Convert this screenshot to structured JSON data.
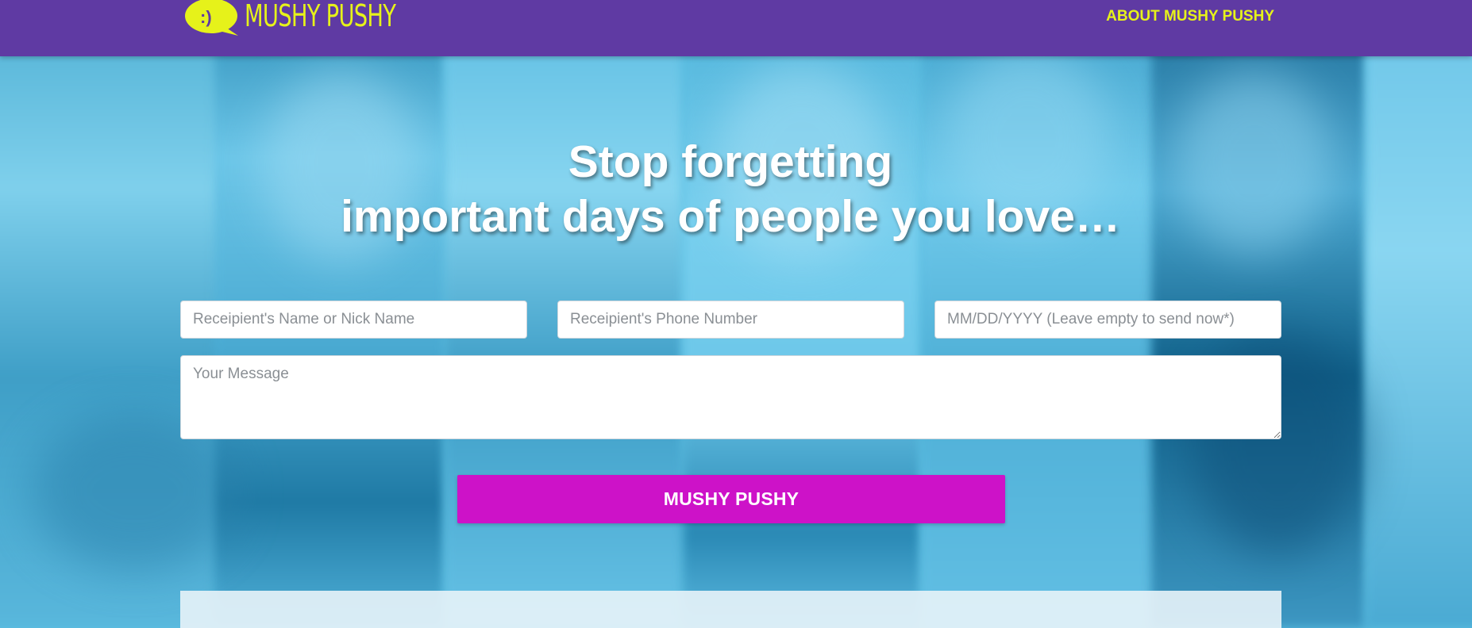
{
  "header": {
    "logo_face": ":)",
    "logo_text": "MUSHY PUSHY",
    "nav_about": "ABOUT MUSHY PUSHY"
  },
  "hero": {
    "line1": "Stop forgetting",
    "line2": "important days of people you love…"
  },
  "form": {
    "name_placeholder": "Receipient's Name or Nick Name",
    "phone_placeholder": "Receipient's Phone Number",
    "date_placeholder": "MM/DD/YYYY (Leave empty to send now*)",
    "message_placeholder": "Your Message",
    "submit_label": "MUSHY PUSHY"
  },
  "bottom_panel": {
    "heading": ""
  },
  "colors": {
    "header_bg": "#5f3aa3",
    "brand_yellow": "#e6f21a",
    "submit_bg": "#cd12c8",
    "hero_overlay": "#5bbfe2"
  },
  "icons": {
    "logo": "speech-bubble-smiley-icon"
  }
}
